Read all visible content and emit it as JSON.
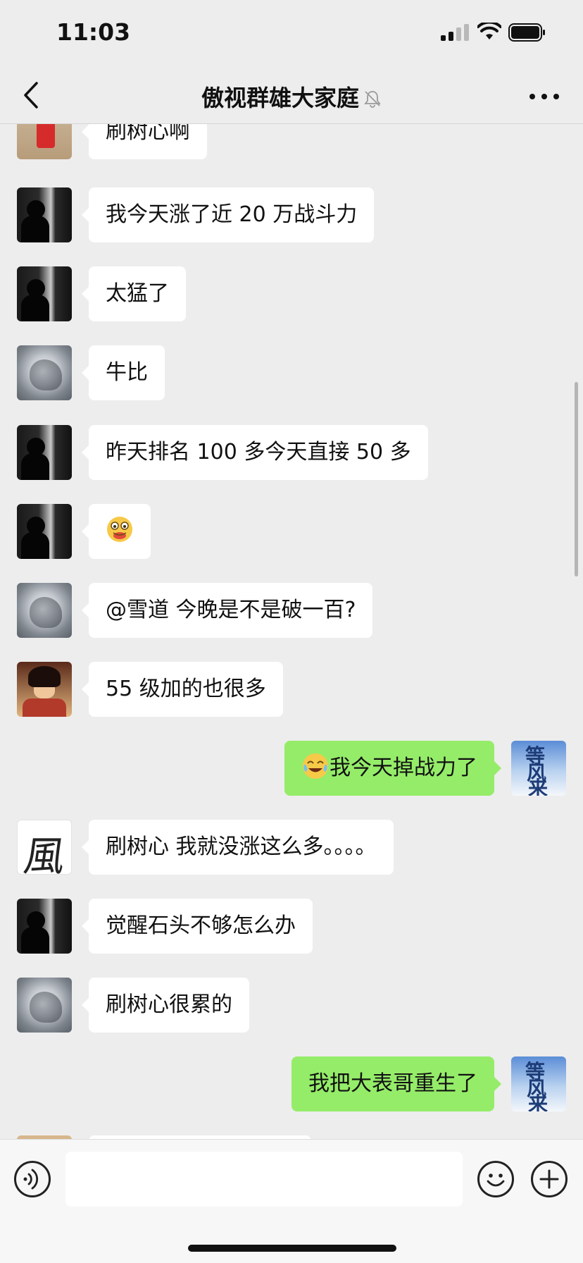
{
  "status_bar": {
    "time": "11:03"
  },
  "nav": {
    "title": "傲视群雄大家庭"
  },
  "messages": [
    {
      "side": "left",
      "avatar": "red-figure-avatar",
      "text": "刷树心啊"
    },
    {
      "side": "left",
      "avatar": "dark-silhouette-avatar",
      "text": "我今天涨了近 20 万战斗力"
    },
    {
      "side": "left",
      "avatar": "dark-silhouette-avatar",
      "text": "太猛了"
    },
    {
      "side": "left",
      "avatar": "gray-bird-avatar",
      "text": "牛比"
    },
    {
      "side": "left",
      "avatar": "dark-silhouette-avatar",
      "text": "昨天排名 100 多今天直接 50 多"
    },
    {
      "side": "left",
      "avatar": "dark-silhouette-avatar",
      "text": "",
      "emoji": "grimace-emoji"
    },
    {
      "side": "left",
      "avatar": "gray-bird-avatar",
      "text": "@雪道 今晚是不是破一百?"
    },
    {
      "side": "left",
      "avatar": "anime-avatar",
      "text": "55 级加的也很多"
    },
    {
      "side": "right",
      "avatar": "cloud-calligraphy-avatar",
      "text": "我今天掉战力了",
      "emoji": "crying-laughing-emoji"
    },
    {
      "side": "left",
      "avatar": "feng-calligraphy-avatar",
      "text": "刷树心 我就没涨这么多。。。。"
    },
    {
      "side": "left",
      "avatar": "dark-silhouette-avatar",
      "text": "觉醒石头不够怎么办"
    },
    {
      "side": "left",
      "avatar": "gray-bird-avatar",
      "text": "刷树心很累的"
    },
    {
      "side": "right",
      "avatar": "cloud-calligraphy-avatar",
      "text": "我把大表哥重生了"
    }
  ],
  "avatar_text": {
    "cloud": [
      "等",
      "风",
      "来"
    ],
    "feng": "風"
  },
  "input": {
    "value": "",
    "placeholder": ""
  },
  "colors": {
    "background": "#ededed",
    "bubble_self": "#95ec69",
    "bubble_other": "#ffffff"
  }
}
